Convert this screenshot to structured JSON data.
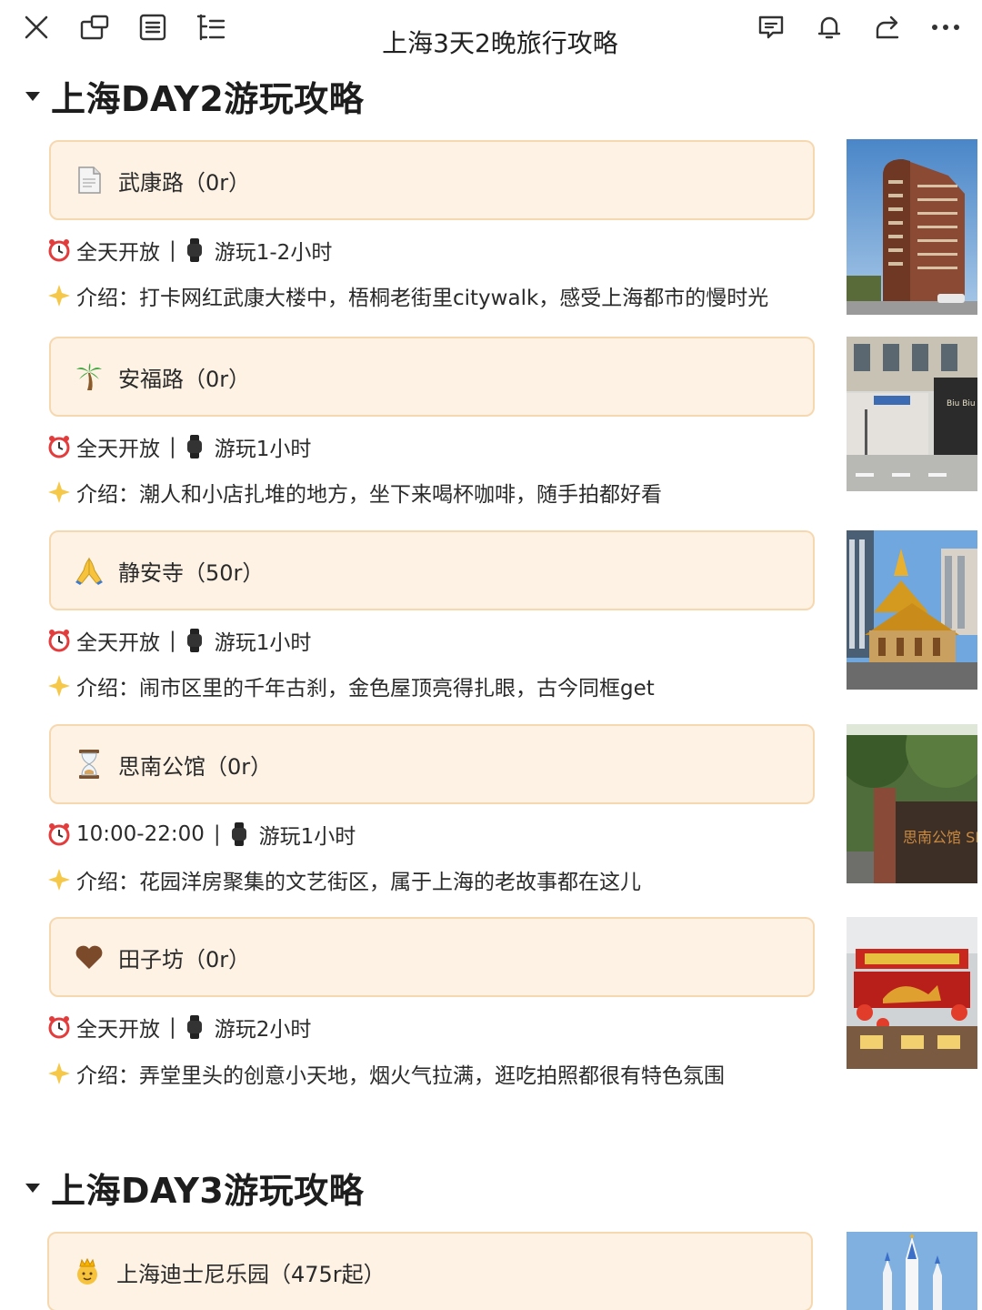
{
  "toolbar": {
    "title": "上海3天2晚旅行攻略",
    "icons": [
      "close-icon",
      "window-icon",
      "outline-icon",
      "list-icon",
      "comment-icon",
      "bell-icon",
      "share-icon",
      "more-icon"
    ]
  },
  "colors": {
    "callout_bg": "#fdf2e4",
    "callout_border": "#f6d8b0"
  },
  "sections": [
    {
      "title": "上海DAY2游玩攻略",
      "spots": [
        {
          "icon": "document-icon",
          "name": "武康路（0r）",
          "hours": "全天开放",
          "duration": "游玩1-2小时",
          "intro": "介绍：打卡网红武康大楼中，梧桐老街里citywalk，感受上海都市的慢时光"
        },
        {
          "icon": "palm-tree-icon",
          "name": "安福路（0r）",
          "hours": "全天开放",
          "duration": "游玩1小时",
          "intro": "介绍：潮人和小店扎堆的地方，坐下来喝杯咖啡，随手拍都好看"
        },
        {
          "icon": "praying-hands-icon",
          "name": "静安寺（50r）",
          "hours": "全天开放",
          "duration": "游玩1小时",
          "intro": "介绍：闹市区里的千年古刹，金色屋顶亮得扎眼，古今同框get"
        },
        {
          "icon": "hourglass-icon",
          "name": "思南公馆（0r）",
          "hours": "10:00-22:00",
          "duration": "游玩1小时",
          "intro": "介绍：花园洋房聚集的文艺街区，属于上海的老故事都在这儿"
        },
        {
          "icon": "heart-icon",
          "name": "田子坊（0r）",
          "hours": "全天开放",
          "duration": "游玩2小时",
          "intro": "介绍：弄堂里头的创意小天地，烟火气拉满，逛吃拍照都很有特色氛围"
        }
      ]
    },
    {
      "title": "上海DAY3游玩攻略",
      "spots": [
        {
          "icon": "princess-icon",
          "name": "上海迪士尼乐园（475r起）"
        }
      ]
    }
  ],
  "photos": [
    {
      "subject": "wukang-mansion",
      "sign_text": ""
    },
    {
      "subject": "anfu-road-street",
      "sign_text": "Biu Biu"
    },
    {
      "subject": "jingan-temple"
    },
    {
      "subject": "sinan-mansions-gate",
      "sign_text": "思南公馆 SINAN MANSIONS"
    },
    {
      "subject": "tianzifang-gate",
      "sign_text": ""
    },
    {
      "subject": "disney-castle"
    }
  ]
}
